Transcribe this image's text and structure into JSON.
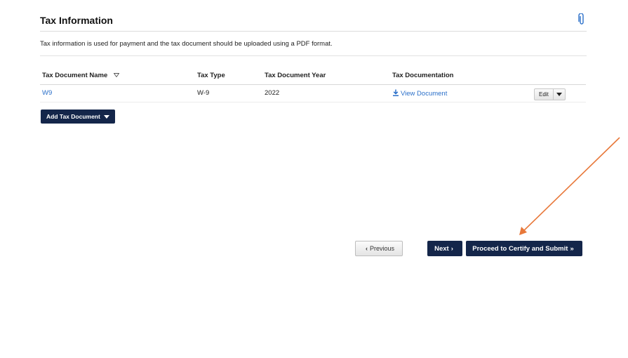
{
  "header": {
    "title": "Tax Information"
  },
  "description": "Tax information is used for payment and the tax document should be uploaded using a PDF format.",
  "table": {
    "columns": [
      "Tax Document Name",
      "Tax Type",
      "Tax Document Year",
      "Tax Documentation"
    ],
    "rows": [
      {
        "name": "W9",
        "type": "W-9",
        "year": "2022",
        "documentation": "View Document",
        "action": "Edit"
      }
    ]
  },
  "buttons": {
    "add_tax_document": "Add Tax Document",
    "previous": "Previous",
    "next": "Next",
    "proceed": "Proceed to Certify and Submit"
  },
  "colors": {
    "primary": "#14264a",
    "link": "#2a6fc9",
    "annotation_arrow": "#e8783a"
  },
  "icons": [
    "paperclip-icon",
    "sort-triangle-icon",
    "download-icon",
    "caret-down-icon",
    "chevron-left-icon",
    "chevron-right-icon",
    "double-chevron-right-icon"
  ]
}
